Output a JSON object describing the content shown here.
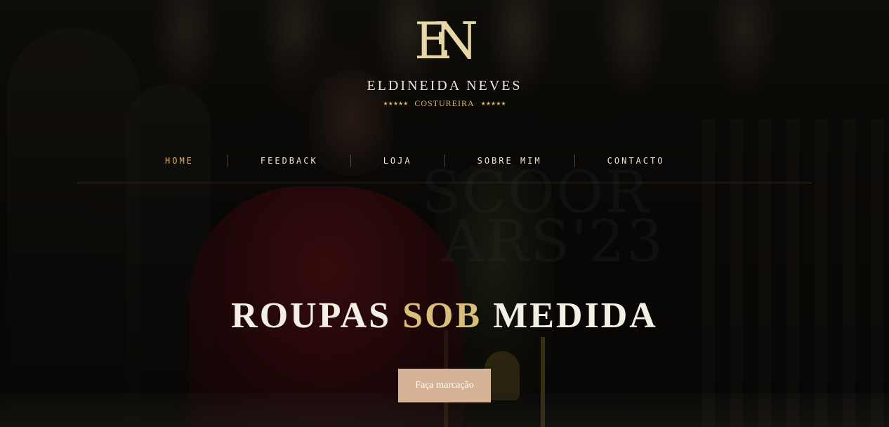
{
  "brand": {
    "logo_letters": [
      "E",
      "N"
    ],
    "name": "ELDINEIDA NEVES",
    "subtitle": "COSTUREIRA",
    "stars": "★★★★★"
  },
  "nav": {
    "items": [
      {
        "label": "HOME",
        "active": true
      },
      {
        "label": "FEEDBACK",
        "active": false
      },
      {
        "label": "LOJA",
        "active": false
      },
      {
        "label": "SOBRE MIM",
        "active": false
      },
      {
        "label": "CONTACTO",
        "active": false
      }
    ]
  },
  "hero": {
    "headline_part1": "ROUPAS",
    "headline_accent": "SOB",
    "headline_part2": "MEDIDA",
    "cta_label": "Faça marcação",
    "background_text_line1": "SCOOR",
    "background_text_line2": "ARS'23"
  },
  "colors": {
    "accent_gold": "#d7b56d",
    "button_bg": "#d6b394",
    "text_light": "#ece6d6"
  }
}
